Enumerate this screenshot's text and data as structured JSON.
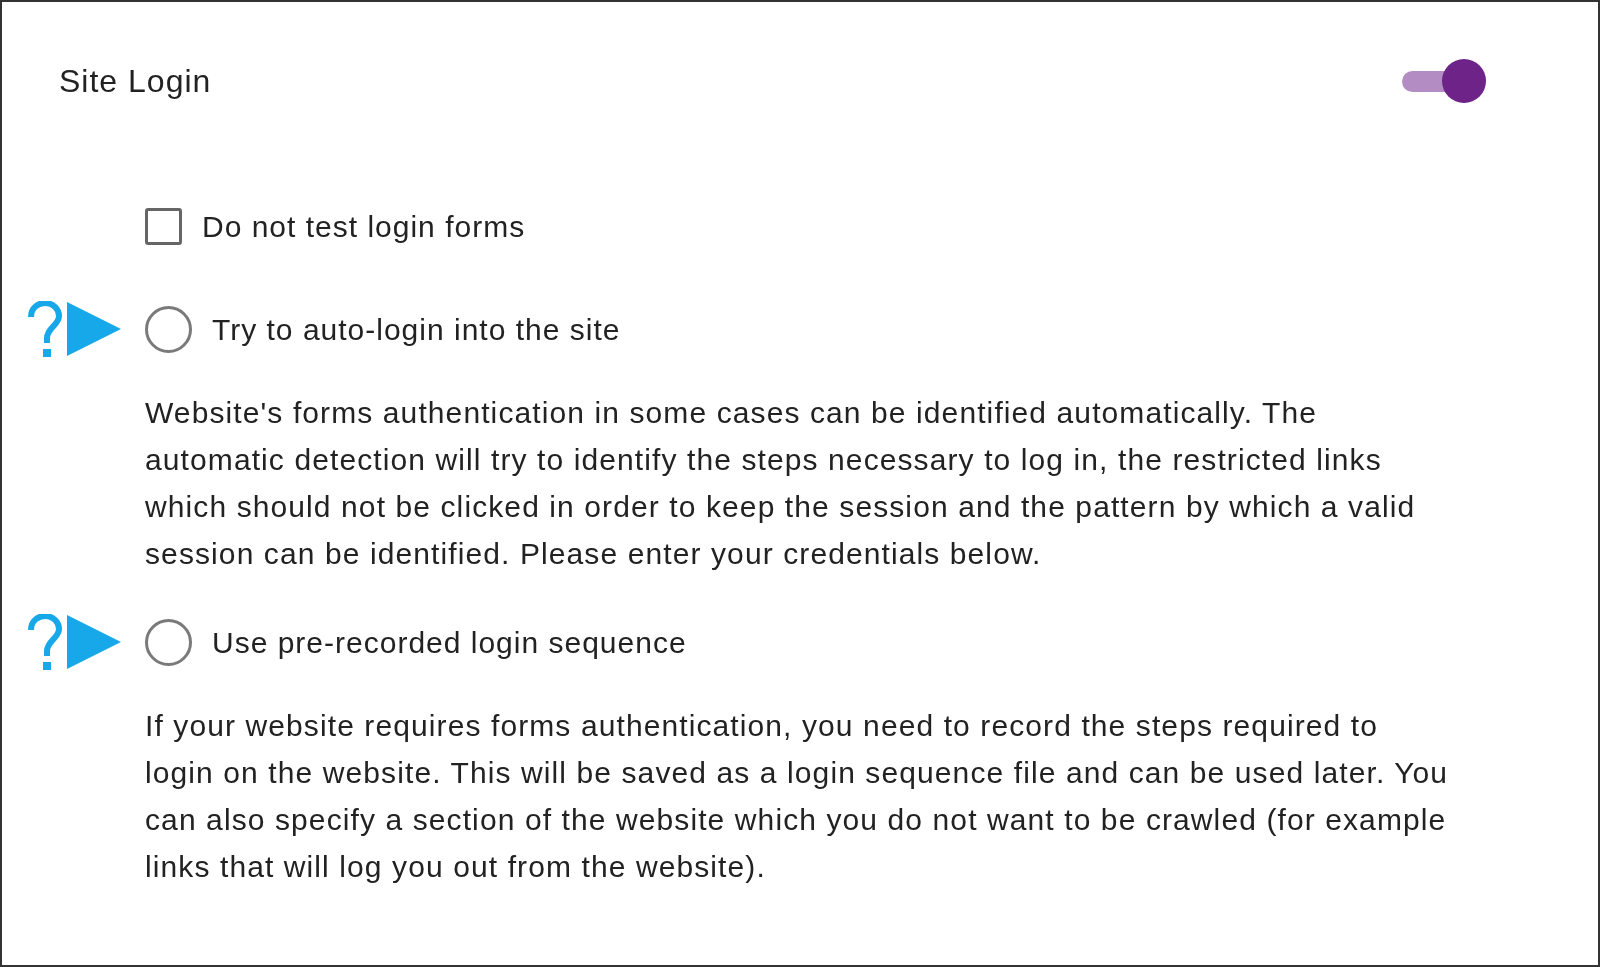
{
  "title": "Site Login",
  "toggle": {
    "on": true
  },
  "options": [
    {
      "kind": "checkbox",
      "label": "Do not test login forms",
      "checked": false
    },
    {
      "kind": "radio",
      "label": "Try to auto-login into the site",
      "selected": false,
      "help": true,
      "description": "Website's forms authentication in some cases can be identified automatically. The automatic detection will try to identify the steps necessary to log in, the restricted links which should not be clicked in order to keep the session and the pattern by which a valid session can be identified. Please enter your credentials below."
    },
    {
      "kind": "radio",
      "label": "Use pre-recorded login sequence",
      "selected": false,
      "help": true,
      "description": "If your website requires forms authentication, you need to record the steps required to login on the website. This will be saved as a login sequence file and can be used later. You can also specify a section of the website which you do not want to be crawled (for example links that will log you out from the website)."
    }
  ]
}
